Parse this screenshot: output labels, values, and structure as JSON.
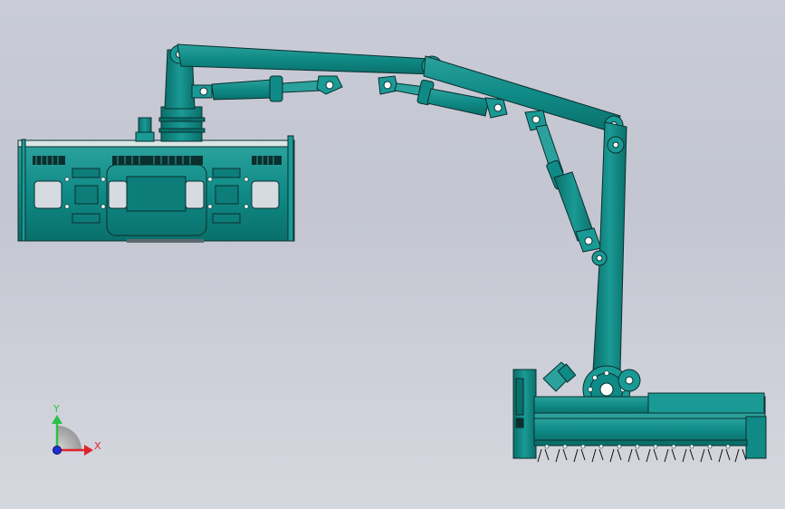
{
  "viewport": {
    "background_top": "#c9ccd7",
    "background_bottom": "#d6d8df"
  },
  "model": {
    "body_color": "#0f8a86",
    "edge_color": "#0b2f2e",
    "shadow_color": "#0a6d6a",
    "highlight_color": "#4fb6b1"
  },
  "triad": {
    "y_label": "Y",
    "x_label": "X",
    "y_color": "#2cc24a",
    "x_color": "#e0242b",
    "z_color": "#1e2fd6"
  }
}
